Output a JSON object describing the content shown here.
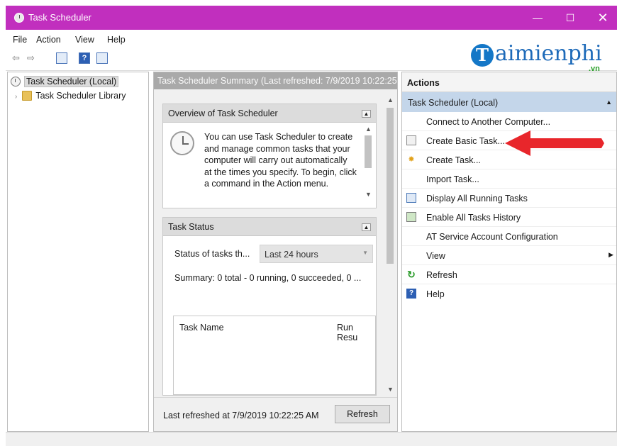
{
  "window": {
    "title": "Task Scheduler",
    "min": "—",
    "max": "☐",
    "close": "✕"
  },
  "menu": [
    "File",
    "Action",
    "View",
    "Help"
  ],
  "toolbar": {
    "back": "⇦",
    "forward": "⇨",
    "help": "?"
  },
  "logo": {
    "letter": "T",
    "text": "aimienphi",
    "suffix": ".vn"
  },
  "tree": [
    {
      "label": "Task Scheduler (Local)",
      "expander": ""
    },
    {
      "label": "Task Scheduler Library",
      "expander": "›"
    }
  ],
  "summary_pane": {
    "header": "Task Scheduler Summary (Last refreshed: 7/9/2019 10:22:25",
    "overview": {
      "title": "Overview of Task Scheduler",
      "text": "You can use Task Scheduler to create and manage common tasks that your computer will carry out automatically at the times you specify. To begin, click a command in the Action menu."
    },
    "status": {
      "title": "Task Status",
      "label": "Status of tasks th...",
      "dropdown": "Last 24 hours",
      "summary": "Summary: 0 total - 0 running, 0 succeeded, 0 ...",
      "columns": [
        "Task Name",
        "Run Resu"
      ]
    },
    "footer": {
      "last_refreshed": "Last refreshed at 7/9/2019 10:22:25 AM",
      "refresh_button": "Refresh"
    }
  },
  "actions": {
    "header": "Actions",
    "group": "Task Scheduler (Local)",
    "items": [
      {
        "label": "Connect to Another Computer...",
        "icon": "none"
      },
      {
        "label": "Create Basic Task...",
        "icon": "task-icon"
      },
      {
        "label": "Create Task...",
        "icon": "star-icon"
      },
      {
        "label": "Import Task...",
        "icon": "none"
      },
      {
        "label": "Display All Running Tasks",
        "icon": "grid-icon"
      },
      {
        "label": "Enable All Tasks History",
        "icon": "history-icon"
      },
      {
        "label": "AT Service Account Configuration",
        "icon": "none"
      },
      {
        "label": "View",
        "icon": "none",
        "submenu": "▶"
      },
      {
        "label": "Refresh",
        "icon": "refresh-icon"
      },
      {
        "label": "Help",
        "icon": "help-icon"
      }
    ]
  },
  "colors": {
    "titlebar": "#c12fbe",
    "selection": "#c4d6ea",
    "arrow": "#e8262b"
  }
}
